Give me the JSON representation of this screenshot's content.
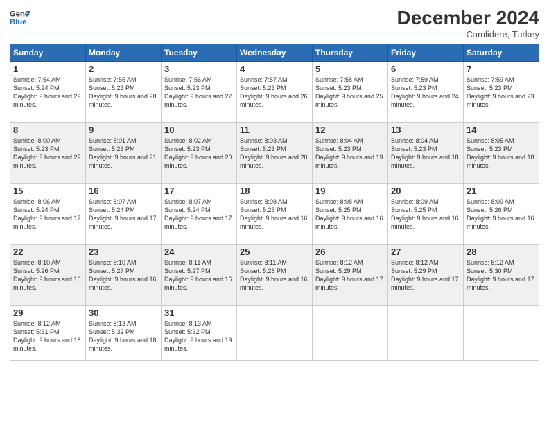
{
  "logo": {
    "line1": "General",
    "line2": "Blue"
  },
  "title": "December 2024",
  "location": "Camlidere, Turkey",
  "weekdays": [
    "Sunday",
    "Monday",
    "Tuesday",
    "Wednesday",
    "Thursday",
    "Friday",
    "Saturday"
  ],
  "weeks": [
    [
      {
        "day": "1",
        "sunrise": "Sunrise: 7:54 AM",
        "sunset": "Sunset: 5:24 PM",
        "daylight": "Daylight: 9 hours and 29 minutes."
      },
      {
        "day": "2",
        "sunrise": "Sunrise: 7:55 AM",
        "sunset": "Sunset: 5:23 PM",
        "daylight": "Daylight: 9 hours and 28 minutes."
      },
      {
        "day": "3",
        "sunrise": "Sunrise: 7:56 AM",
        "sunset": "Sunset: 5:23 PM",
        "daylight": "Daylight: 9 hours and 27 minutes."
      },
      {
        "day": "4",
        "sunrise": "Sunrise: 7:57 AM",
        "sunset": "Sunset: 5:23 PM",
        "daylight": "Daylight: 9 hours and 26 minutes."
      },
      {
        "day": "5",
        "sunrise": "Sunrise: 7:58 AM",
        "sunset": "Sunset: 5:23 PM",
        "daylight": "Daylight: 9 hours and 25 minutes."
      },
      {
        "day": "6",
        "sunrise": "Sunrise: 7:59 AM",
        "sunset": "Sunset: 5:23 PM",
        "daylight": "Daylight: 9 hours and 24 minutes."
      },
      {
        "day": "7",
        "sunrise": "Sunrise: 7:59 AM",
        "sunset": "Sunset: 5:23 PM",
        "daylight": "Daylight: 9 hours and 23 minutes."
      }
    ],
    [
      {
        "day": "8",
        "sunrise": "Sunrise: 8:00 AM",
        "sunset": "Sunset: 5:23 PM",
        "daylight": "Daylight: 9 hours and 22 minutes."
      },
      {
        "day": "9",
        "sunrise": "Sunrise: 8:01 AM",
        "sunset": "Sunset: 5:23 PM",
        "daylight": "Daylight: 9 hours and 21 minutes."
      },
      {
        "day": "10",
        "sunrise": "Sunrise: 8:02 AM",
        "sunset": "Sunset: 5:23 PM",
        "daylight": "Daylight: 9 hours and 20 minutes."
      },
      {
        "day": "11",
        "sunrise": "Sunrise: 8:03 AM",
        "sunset": "Sunset: 5:23 PM",
        "daylight": "Daylight: 9 hours and 20 minutes."
      },
      {
        "day": "12",
        "sunrise": "Sunrise: 8:04 AM",
        "sunset": "Sunset: 5:23 PM",
        "daylight": "Daylight: 9 hours and 19 minutes."
      },
      {
        "day": "13",
        "sunrise": "Sunrise: 8:04 AM",
        "sunset": "Sunset: 5:23 PM",
        "daylight": "Daylight: 9 hours and 18 minutes."
      },
      {
        "day": "14",
        "sunrise": "Sunrise: 8:05 AM",
        "sunset": "Sunset: 5:23 PM",
        "daylight": "Daylight: 9 hours and 18 minutes."
      }
    ],
    [
      {
        "day": "15",
        "sunrise": "Sunrise: 8:06 AM",
        "sunset": "Sunset: 5:24 PM",
        "daylight": "Daylight: 9 hours and 17 minutes."
      },
      {
        "day": "16",
        "sunrise": "Sunrise: 8:07 AM",
        "sunset": "Sunset: 5:24 PM",
        "daylight": "Daylight: 9 hours and 17 minutes."
      },
      {
        "day": "17",
        "sunrise": "Sunrise: 8:07 AM",
        "sunset": "Sunset: 5:24 PM",
        "daylight": "Daylight: 9 hours and 17 minutes."
      },
      {
        "day": "18",
        "sunrise": "Sunrise: 8:08 AM",
        "sunset": "Sunset: 5:25 PM",
        "daylight": "Daylight: 9 hours and 16 minutes."
      },
      {
        "day": "19",
        "sunrise": "Sunrise: 8:08 AM",
        "sunset": "Sunset: 5:25 PM",
        "daylight": "Daylight: 9 hours and 16 minutes."
      },
      {
        "day": "20",
        "sunrise": "Sunrise: 8:09 AM",
        "sunset": "Sunset: 5:25 PM",
        "daylight": "Daylight: 9 hours and 16 minutes."
      },
      {
        "day": "21",
        "sunrise": "Sunrise: 8:09 AM",
        "sunset": "Sunset: 5:26 PM",
        "daylight": "Daylight: 9 hours and 16 minutes."
      }
    ],
    [
      {
        "day": "22",
        "sunrise": "Sunrise: 8:10 AM",
        "sunset": "Sunset: 5:26 PM",
        "daylight": "Daylight: 9 hours and 16 minutes."
      },
      {
        "day": "23",
        "sunrise": "Sunrise: 8:10 AM",
        "sunset": "Sunset: 5:27 PM",
        "daylight": "Daylight: 9 hours and 16 minutes."
      },
      {
        "day": "24",
        "sunrise": "Sunrise: 8:11 AM",
        "sunset": "Sunset: 5:27 PM",
        "daylight": "Daylight: 9 hours and 16 minutes."
      },
      {
        "day": "25",
        "sunrise": "Sunrise: 8:11 AM",
        "sunset": "Sunset: 5:28 PM",
        "daylight": "Daylight: 9 hours and 16 minutes."
      },
      {
        "day": "26",
        "sunrise": "Sunrise: 8:12 AM",
        "sunset": "Sunset: 5:29 PM",
        "daylight": "Daylight: 9 hours and 17 minutes."
      },
      {
        "day": "27",
        "sunrise": "Sunrise: 8:12 AM",
        "sunset": "Sunset: 5:29 PM",
        "daylight": "Daylight: 9 hours and 17 minutes."
      },
      {
        "day": "28",
        "sunrise": "Sunrise: 8:12 AM",
        "sunset": "Sunset: 5:30 PM",
        "daylight": "Daylight: 9 hours and 17 minutes."
      }
    ],
    [
      {
        "day": "29",
        "sunrise": "Sunrise: 8:12 AM",
        "sunset": "Sunset: 5:31 PM",
        "daylight": "Daylight: 9 hours and 18 minutes."
      },
      {
        "day": "30",
        "sunrise": "Sunrise: 8:13 AM",
        "sunset": "Sunset: 5:32 PM",
        "daylight": "Daylight: 9 hours and 18 minutes."
      },
      {
        "day": "31",
        "sunrise": "Sunrise: 8:13 AM",
        "sunset": "Sunset: 5:32 PM",
        "daylight": "Daylight: 9 hours and 19 minutes."
      },
      null,
      null,
      null,
      null
    ]
  ]
}
